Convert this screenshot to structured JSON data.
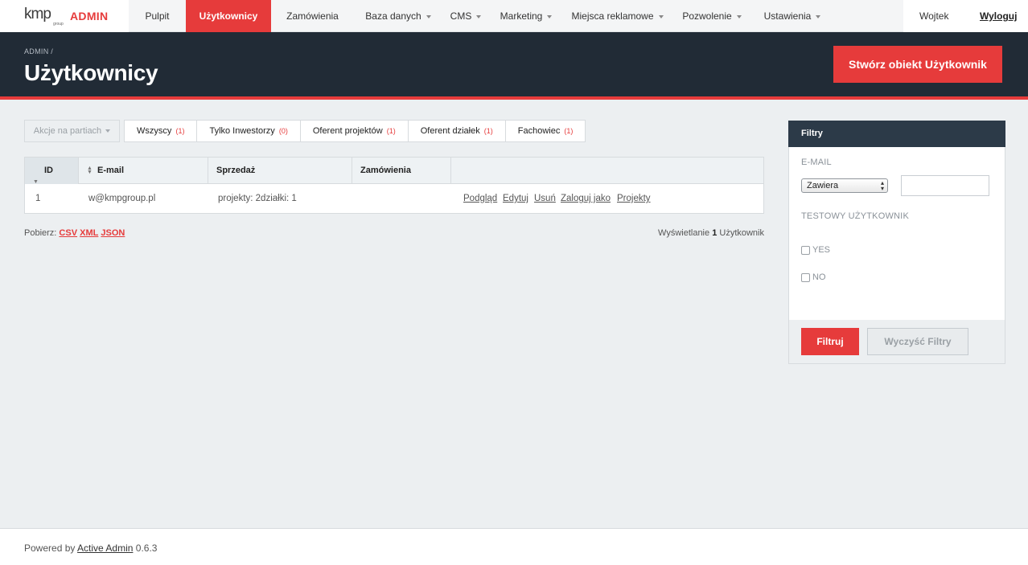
{
  "logo": {
    "wordmark": "kmp",
    "sub": "group",
    "admin": "ADMIN"
  },
  "nav": {
    "items": [
      {
        "label": "Pulpit"
      },
      {
        "label": "Użytkownicy"
      },
      {
        "label": "Zamówienia"
      },
      {
        "label": "Baza danych"
      },
      {
        "label": "CMS"
      },
      {
        "label": "Marketing"
      },
      {
        "label": "Miejsca reklamowe"
      },
      {
        "label": "Pozwolenie"
      },
      {
        "label": "Ustawienia"
      }
    ],
    "user": "Wojtek",
    "logout": "Wyloguj"
  },
  "header": {
    "breadcrumb": "ADMIN /",
    "title": "Użytkownicy",
    "create_button": "Stwórz obiekt Użytkownik"
  },
  "batch": {
    "label": "Akcje na partiach"
  },
  "scopes": [
    {
      "label": "Wszyscy",
      "count": "(1)"
    },
    {
      "label": "Tylko Inwestorzy",
      "count": "(0)"
    },
    {
      "label": "Oferent projektów",
      "count": "(1)"
    },
    {
      "label": "Oferent działek",
      "count": "(1)"
    },
    {
      "label": "Fachowiec",
      "count": "(1)"
    }
  ],
  "table": {
    "columns": [
      "ID",
      "E-mail",
      "Sprzedaż",
      "Zamówienia"
    ],
    "rows": [
      {
        "id": "1",
        "email": "w@kmpgroup.pl",
        "sales": "projekty: 2działki: 1",
        "orders": "",
        "actions": [
          "Podgląd",
          "Edytuj",
          "Usuń",
          "Zaloguj jako",
          "Projekty"
        ]
      }
    ]
  },
  "download": {
    "label": "Pobierz:",
    "formats": [
      "CSV",
      "XML",
      "JSON"
    ]
  },
  "pagination": {
    "prefix": "Wyświetlanie",
    "count": "1",
    "suffix": "Użytkownik"
  },
  "filters": {
    "title": "Filtry",
    "email_label": "E-MAIL",
    "email_operator": "Zawiera",
    "email_value": "",
    "test_user_label": "TESTOWY UŻYTKOWNIK",
    "options": [
      "YES",
      "NO"
    ],
    "submit": "Filtruj",
    "clear": "Wyczyść Filtry"
  },
  "footer": {
    "prefix": "Powered by",
    "link": "Active Admin",
    "version": "0.6.3"
  },
  "colors": {
    "accent": "#e63b3b",
    "header_bg": "#212b36",
    "filters_head_bg": "#2c3a48"
  }
}
